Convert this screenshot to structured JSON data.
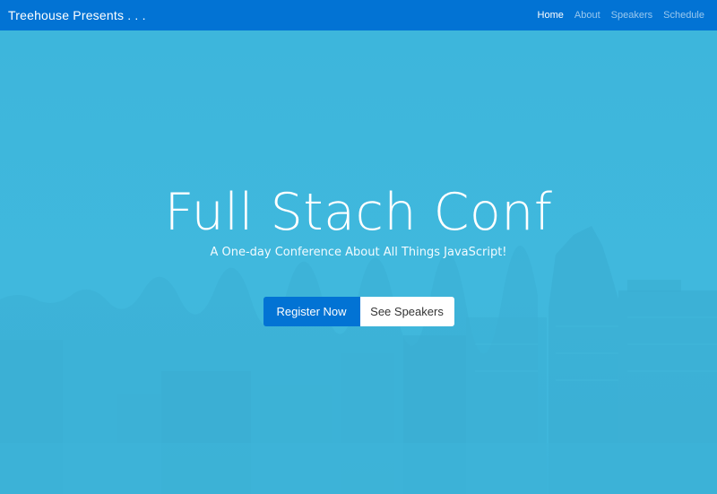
{
  "navbar": {
    "brand": "Treehouse Presents . . .",
    "links": [
      {
        "label": "Home",
        "active": true
      },
      {
        "label": "About",
        "active": false
      },
      {
        "label": "Speakers",
        "active": false
      },
      {
        "label": "Schedule",
        "active": false
      }
    ]
  },
  "hero": {
    "title": "Full Stach Conf",
    "subtitle": "A One-day Conference About All Things JavaScript!",
    "primary_button": "Register Now",
    "secondary_button": "See Speakers"
  },
  "colors": {
    "navbar_bg": "#0273d4",
    "hero_bg": "#3fb8dc",
    "primary_button": "#0273d4",
    "secondary_button": "#ffffff"
  }
}
